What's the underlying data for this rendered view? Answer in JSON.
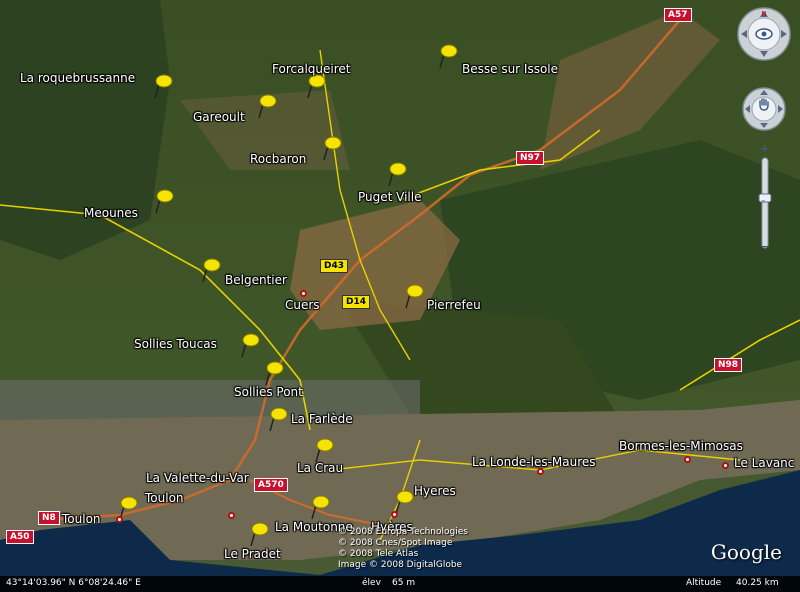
{
  "places": [
    {
      "id": "la-roquebrussanne",
      "label": "La roquebrussanne"
    },
    {
      "id": "forcalqueiret",
      "label": "Forcalqueiret"
    },
    {
      "id": "besse-sur-issole",
      "label": "Besse sur Issole"
    },
    {
      "id": "gareoult",
      "label": "Gareoult"
    },
    {
      "id": "rocbaron",
      "label": "Rocbaron"
    },
    {
      "id": "puget-ville",
      "label": "Puget Ville"
    },
    {
      "id": "meounes",
      "label": "Meounes"
    },
    {
      "id": "belgentier",
      "label": "Belgentier"
    },
    {
      "id": "cuers",
      "label": "Cuers"
    },
    {
      "id": "pierrefeu",
      "label": "Pierrefeu"
    },
    {
      "id": "sollies-toucas",
      "label": "Sollies Toucas"
    },
    {
      "id": "sollies-pont",
      "label": "Sollies Pont"
    },
    {
      "id": "la-farlede",
      "label": "La Farlède"
    },
    {
      "id": "la-crau",
      "label": "La Crau"
    },
    {
      "id": "la-valette-du-var",
      "label": "La Valette-du-Var"
    },
    {
      "id": "toulon-pin",
      "label": "Toulon"
    },
    {
      "id": "toulon-city",
      "label": "Toulon"
    },
    {
      "id": "la-moutonne",
      "label": "La Moutonne"
    },
    {
      "id": "hyeres-pin",
      "label": "Hyeres"
    },
    {
      "id": "hyeres-city",
      "label": "Hyères"
    },
    {
      "id": "le-pradet",
      "label": "Le Pradet"
    },
    {
      "id": "la-londe",
      "label": "La Londe-les-Maures"
    },
    {
      "id": "bormes",
      "label": "Bormes-les-Mimosas"
    },
    {
      "id": "le-lavandou",
      "label": "Le Lavanc"
    }
  ],
  "roads": [
    {
      "id": "a57",
      "label": "A57",
      "style": "red"
    },
    {
      "id": "n97",
      "label": "N97",
      "style": "red"
    },
    {
      "id": "d43",
      "label": "D43",
      "style": "yellow"
    },
    {
      "id": "d14",
      "label": "D14",
      "style": "yellow"
    },
    {
      "id": "n98",
      "label": "N98",
      "style": "red"
    },
    {
      "id": "a570",
      "label": "A570",
      "style": "red"
    },
    {
      "id": "n8",
      "label": "N8",
      "style": "red"
    },
    {
      "id": "a50",
      "label": "A50",
      "style": "red"
    }
  ],
  "copyright_lines": [
    "© 2008 Europa Technologies",
    "© 2008 Cnes/Spot Image",
    "© 2008 Tele Atlas",
    "Image © 2008 DigitalGlobe"
  ],
  "logo": "Google",
  "status": {
    "coords": "43°14'03.96\" N      6°08'24.46\" E",
    "elev_label": "élev",
    "elev_value": "65 m",
    "altitude_label": "Altitude",
    "altitude_value": "40.25 km"
  },
  "controls": {
    "look_icon": "eye-icon",
    "move_icon": "hand-icon",
    "zoom_in": "+",
    "zoom_out": "−"
  },
  "colors": {
    "pin": "#f4e400",
    "road_red": "#c8102e",
    "road_yellow": "#f4e400",
    "sea": "#0d2a4a"
  }
}
